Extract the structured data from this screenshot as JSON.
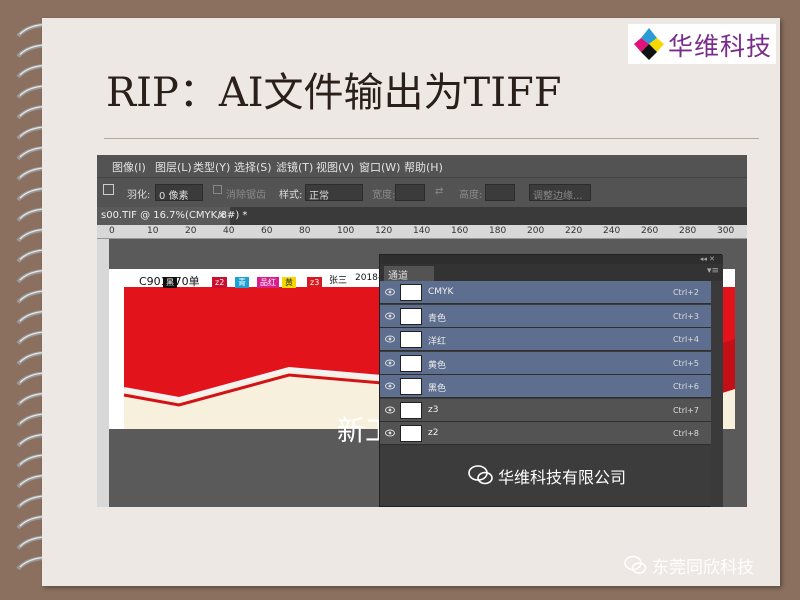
{
  "logo": {
    "text": "华维科技",
    "colors": [
      "#2b9bd6",
      "#e2127a",
      "#f5d800",
      "#111111"
    ]
  },
  "slide": {
    "title": "RIP：AI文件输出为TIFF"
  },
  "ps": {
    "menu": [
      "图像(I)",
      "图层(L)",
      "类型(Y)",
      "选择(S)",
      "滤镜(T)",
      "视图(V)",
      "窗口(W)",
      "帮助(H)"
    ],
    "options": {
      "feather_label": "羽化:",
      "feather_value": "0 像素",
      "antialias_label": "消除锯齿",
      "style_label": "样式:",
      "style_value": "正常",
      "width_label": "宽度:",
      "height_label": "高度:",
      "refine_label": "调整边缘..."
    },
    "doc_tab": "s00.TIF @ 16.7%(CMYK/8#) *",
    "doc_tab_close": "×",
    "ruler": [
      "0",
      "10",
      "20",
      "40",
      "60",
      "80",
      "100",
      "120",
      "140",
      "160",
      "180",
      "200",
      "220",
      "240",
      "260",
      "280",
      "300"
    ],
    "doc": {
      "header": "C901270单",
      "chips": [
        {
          "text": "黑",
          "color": "#111111"
        },
        {
          "text": "z2",
          "color": "#c8102e"
        },
        {
          "text": "青",
          "color": "#1e9fd6"
        },
        {
          "text": "品红",
          "color": "#d61f8c"
        },
        {
          "text": "黄",
          "color": "#f5d800"
        },
        {
          "text": "z3",
          "color": "#d81920"
        }
      ],
      "name": "张三",
      "date": "2018-1",
      "visible_text": "新工"
    },
    "channels_panel": {
      "collapse": "◂◂ ✕",
      "tab": "通道",
      "rows": [
        {
          "name": "CMYK",
          "shortcut": "Ctrl+2",
          "selected": true
        },
        {
          "name": "青色",
          "shortcut": "Ctrl+3",
          "selected": true
        },
        {
          "name": "洋红",
          "shortcut": "Ctrl+4",
          "selected": true
        },
        {
          "name": "黄色",
          "shortcut": "Ctrl+5",
          "selected": true
        },
        {
          "name": "黑色",
          "shortcut": "Ctrl+6",
          "selected": true
        },
        {
          "name": "z3",
          "shortcut": "Ctrl+7",
          "selected": false
        },
        {
          "name": "z2",
          "shortcut": "Ctrl+8",
          "selected": false
        }
      ]
    }
  },
  "watermarks": {
    "company": "华维科技有限公司",
    "account": "东莞同欣科技"
  }
}
